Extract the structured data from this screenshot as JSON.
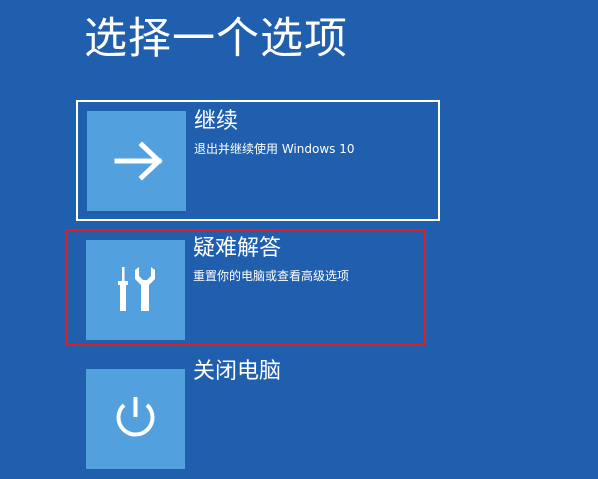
{
  "header": {
    "title": "选择一个选项"
  },
  "options": [
    {
      "title": "继续",
      "description": "退出并继续使用 Windows 10",
      "icon": "arrow-right-icon"
    },
    {
      "title": "疑难解答",
      "description": "重置你的电脑或查看高级选项",
      "icon": "tools-icon"
    },
    {
      "title": "关闭电脑",
      "icon": "power-icon"
    }
  ],
  "colors": {
    "background": "#1f5fae",
    "tile": "#53a0de",
    "text": "#ffffff",
    "highlight": "#e02020"
  }
}
